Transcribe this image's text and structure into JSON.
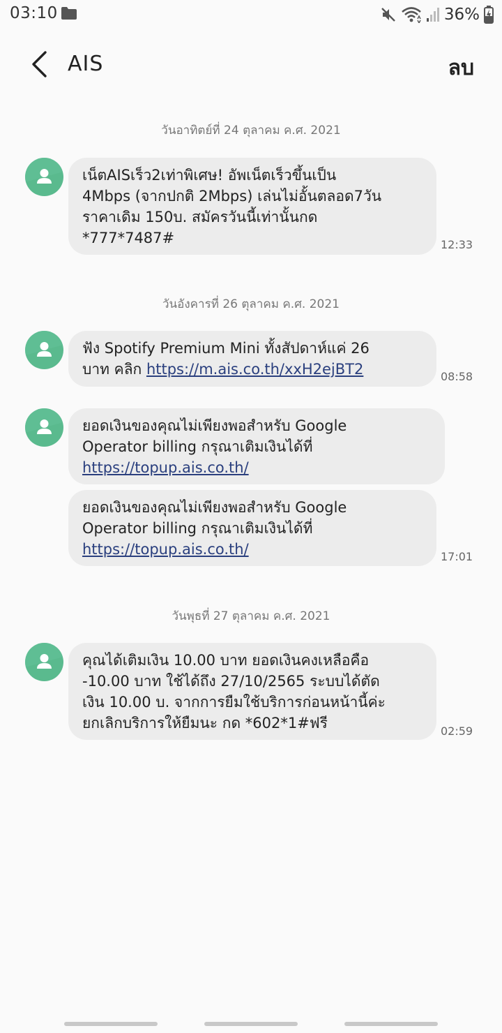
{
  "status_bar": {
    "time": "03:10",
    "battery": "36%",
    "icons": [
      "folder-icon",
      "mute-icon",
      "wifi-icon",
      "signal-icon",
      "battery-charging-icon"
    ]
  },
  "header": {
    "title": "AIS",
    "delete_label": "ลบ",
    "back_icon": "back-arrow-icon"
  },
  "messages": [
    {
      "date": "วันอาทิตย์ที่ 24 ตุลาคม ค.ศ. 2021",
      "text": "เน็ตAISเร็ว2เท่าพิเศษ! อัพเน็ตเร็วขึ้นเป็น\n4Mbps (จากปกติ 2Mbps) เล่นไม่อั้นตลอด7วัน\nราคาเดิม 150บ. สมัครวันนี้เท่านั้นกด\n*777*7487#",
      "time": "12:33"
    },
    {
      "date": "วันอังคารที่ 26 ตุลาคม ค.ศ. 2021",
      "text": "ฟัง Spotify Premium Mini ทั้งสัปดาห์แค่ 26\nบาท คลิก ",
      "link": "https://m.ais.co.th/xxH2ejBT2",
      "time": "08:58"
    },
    {
      "text": "ยอดเงินของคุณไม่เพียงพอสำหรับ Google\nOperator billing กรุณาเติมเงินได้ที่\n",
      "link": "https://topup.ais.co.th/"
    },
    {
      "text": "ยอดเงินของคุณไม่เพียงพอสำหรับ Google\nOperator billing กรุณาเติมเงินได้ที่\n",
      "link": "https://topup.ais.co.th/",
      "time": "17:01"
    },
    {
      "date": "วันพุธที่ 27 ตุลาคม ค.ศ. 2021",
      "text": "คุณได้เติมเงิน 10.00 บาท ยอดเงินคงเหลือคือ\n-10.00 บาท ใช้ได้ถึง 27/10/2565 ระบบได้ตัด\nเงิน 10.00 บ. จากการยืมใช้บริการก่อนหน้านี้ค่ะ\nยกเลิกบริการให้ยืมนะ กด *602*1#ฟรี",
      "time": "02:59"
    }
  ]
}
